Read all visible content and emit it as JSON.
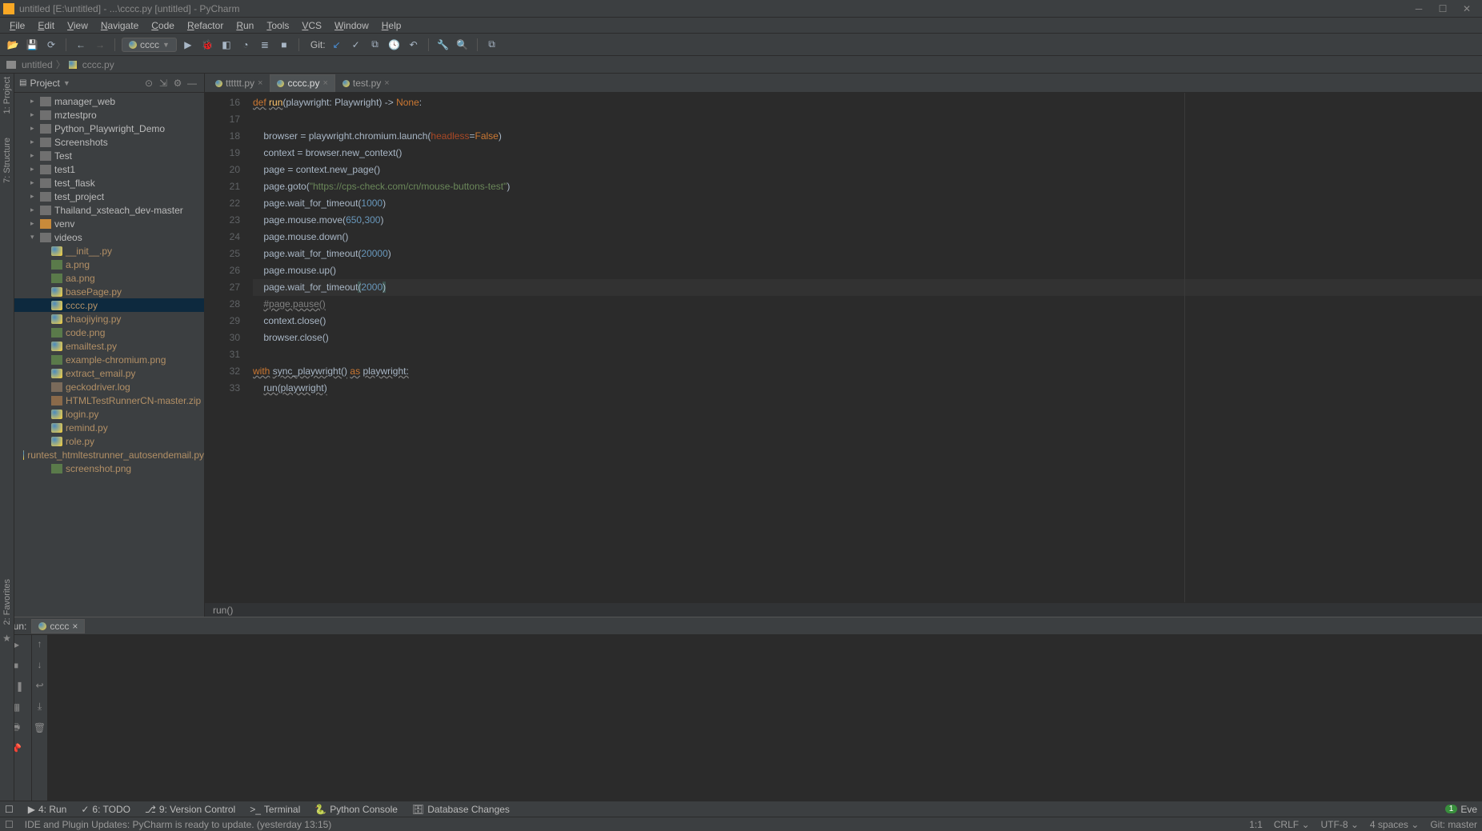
{
  "title": "untitled [E:\\untitled] - ...\\cccc.py [untitled] - PyCharm",
  "menu": [
    "File",
    "Edit",
    "View",
    "Navigate",
    "Code",
    "Refactor",
    "Run",
    "Tools",
    "VCS",
    "Window",
    "Help"
  ],
  "toolbar": {
    "run_config": "cccc",
    "git_label": "Git:"
  },
  "breadcrumb": {
    "root": "untitled",
    "file": "cccc.py"
  },
  "project_panel": {
    "title": "Project",
    "tree": [
      {
        "type": "folder",
        "label": "manager_web",
        "indent": 1,
        "arrow": true
      },
      {
        "type": "folder",
        "label": "mztestpro",
        "indent": 1,
        "arrow": true
      },
      {
        "type": "folder",
        "label": "Python_Playwright_Demo",
        "indent": 1,
        "arrow": true
      },
      {
        "type": "folder",
        "label": "Screenshots",
        "indent": 1,
        "arrow": true
      },
      {
        "type": "folder",
        "label": "Test",
        "indent": 1,
        "arrow": true
      },
      {
        "type": "folder",
        "label": "test1",
        "indent": 1,
        "arrow": true
      },
      {
        "type": "folder",
        "label": "test_flask",
        "indent": 1,
        "arrow": true
      },
      {
        "type": "folder",
        "label": "test_project",
        "indent": 1,
        "arrow": true
      },
      {
        "type": "folder",
        "label": "Thailand_xsteach_dev-master",
        "indent": 1,
        "arrow": true
      },
      {
        "type": "folder-o",
        "label": "venv",
        "indent": 1,
        "arrow": true
      },
      {
        "type": "folder",
        "label": "videos",
        "indent": 1,
        "arrow": true,
        "open": true
      },
      {
        "type": "py",
        "label": "__init__.py",
        "indent": 2
      },
      {
        "type": "img",
        "label": "a.png",
        "indent": 2
      },
      {
        "type": "img",
        "label": "aa.png",
        "indent": 2
      },
      {
        "type": "py",
        "label": "basePage.py",
        "indent": 2
      },
      {
        "type": "py",
        "label": "cccc.py",
        "indent": 2,
        "selected": true
      },
      {
        "type": "py",
        "label": "chaojiying.py",
        "indent": 2
      },
      {
        "type": "img",
        "label": "code.png",
        "indent": 2
      },
      {
        "type": "py",
        "label": "emailtest.py",
        "indent": 2
      },
      {
        "type": "img",
        "label": "example-chromium.png",
        "indent": 2
      },
      {
        "type": "py",
        "label": "extract_email.py",
        "indent": 2
      },
      {
        "type": "log",
        "label": "geckodriver.log",
        "indent": 2
      },
      {
        "type": "zip",
        "label": "HTMLTestRunnerCN-master.zip",
        "indent": 2
      },
      {
        "type": "py",
        "label": "login.py",
        "indent": 2
      },
      {
        "type": "py",
        "label": "remind.py",
        "indent": 2
      },
      {
        "type": "py",
        "label": "role.py",
        "indent": 2
      },
      {
        "type": "py",
        "label": "runtest_htmltestrunner_autosendemail.py",
        "indent": 2
      },
      {
        "type": "img",
        "label": "screenshot.png",
        "indent": 2
      }
    ]
  },
  "left_rail": [
    "1: Project",
    "7: Structure"
  ],
  "fav_rail": "2: Favorites",
  "editor": {
    "tabs": [
      {
        "name": "tttttt.py",
        "active": false
      },
      {
        "name": "cccc.py",
        "active": true
      },
      {
        "name": "test.py",
        "active": false
      }
    ],
    "lines": [
      {
        "n": 16,
        "html": "<span class='kw und'>def</span> <span class='fn und'>run</span>(playwright: <span class='cls'>Playwright</span>) -&gt; <span class='kw'>None</span>:"
      },
      {
        "n": 17,
        "html": ""
      },
      {
        "n": 18,
        "html": "    browser = playwright.chromium.launch(<span class='par'>headless</span>=<span class='kw'>False</span>)"
      },
      {
        "n": 19,
        "html": "    context = browser.new_context()"
      },
      {
        "n": 20,
        "html": "    page = context.new_page()"
      },
      {
        "n": 21,
        "html": "    page.goto(<span class='str'>\"https://cps-check.com/cn/mouse-buttons-test\"</span>)"
      },
      {
        "n": 22,
        "html": "    page.wait_for_timeout(<span class='num'>1000</span>)"
      },
      {
        "n": 23,
        "html": "    page.mouse.move(<span class='num'>650</span>,<span class='num'>300</span>)"
      },
      {
        "n": 24,
        "html": "    page.mouse.down()"
      },
      {
        "n": 25,
        "html": "    page.wait_for_timeout(<span class='num'>20000</span>)"
      },
      {
        "n": 26,
        "html": "    page.mouse.up()"
      },
      {
        "n": 27,
        "html": "    page.wait_for_timeout<span class='hl-paren'>(</span><span class='num'>2000</span><span class='hl-paren'>)</span>",
        "cur": true
      },
      {
        "n": 28,
        "html": "    <span class='cmt und'>#page.pause()</span>"
      },
      {
        "n": 29,
        "html": "    context.close()"
      },
      {
        "n": 30,
        "html": "    browser.close()"
      },
      {
        "n": 31,
        "html": ""
      },
      {
        "n": 32,
        "html": "<span class='kw und'>with</span> <span class='und'>sync_playwright()</span> <span class='kw und'>as</span> <span class='und'>playwright:</span>"
      },
      {
        "n": 33,
        "html": "    <span class='und'>run(playwright)</span>"
      }
    ],
    "crumb": "run()"
  },
  "run_panel": {
    "label": "Run:",
    "tab": "cccc"
  },
  "bottom_bar": {
    "items": [
      "4: Run",
      "6: TODO",
      "9: Version Control",
      "Terminal",
      "Python Console",
      "Database Changes"
    ],
    "event_count": "1",
    "event_label": "Eve"
  },
  "statusbar": {
    "msg": "IDE and Plugin Updates: PyCharm is ready to update. (yesterday 13:15)",
    "pos": "1:1",
    "eol": "CRLF",
    "enc": "UTF-8",
    "indent": "4 spaces",
    "branch": "Git: master"
  }
}
